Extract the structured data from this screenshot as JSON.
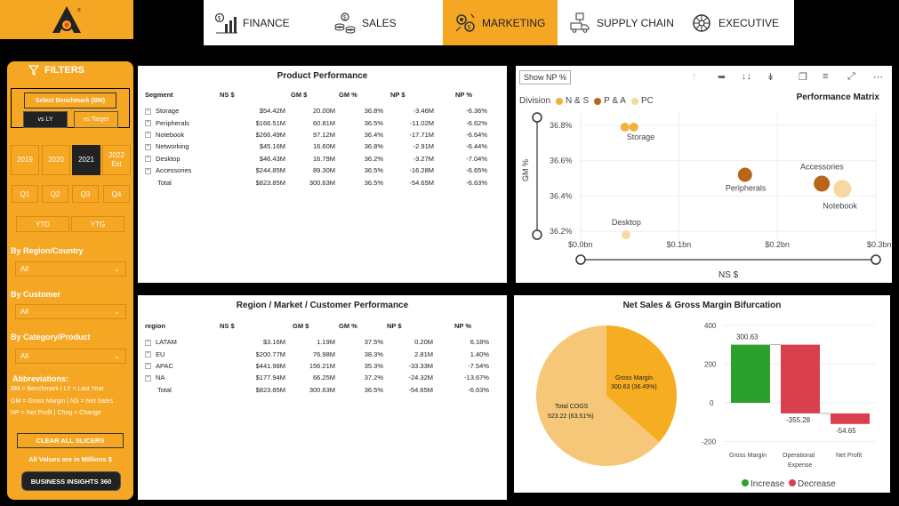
{
  "colors": {
    "accent": "#f5a623",
    "dark": "#222222",
    "increase": "#2ca02c",
    "decrease": "#d9404e",
    "ns": "#f2b13b",
    "pa": "#b8651a",
    "pc": "#f6d9a0",
    "pie_cogs": "#f6c778",
    "pie_gm": "#f6ad22"
  },
  "nav": {
    "tabs": [
      {
        "label": "FINANCE",
        "icon": "finance-chart-icon"
      },
      {
        "label": "SALES",
        "icon": "sales-coins-icon"
      },
      {
        "label": "MARKETING",
        "icon": "marketing-gears-icon",
        "active": true
      },
      {
        "label": "SUPPLY CHAIN",
        "icon": "supply-chain-truck-icon"
      },
      {
        "label": "EXECUTIVE",
        "icon": "executive-wheel-icon"
      }
    ]
  },
  "sidebar": {
    "title": "FILTERS",
    "benchmark_title": "Select Benchmark (BM)",
    "benchmark_options": [
      "vs LY",
      "vs Target"
    ],
    "years": [
      "2019",
      "2020",
      "2021",
      "2022 Est"
    ],
    "quarters": [
      "Q1",
      "Q2",
      "Q3",
      "Q4"
    ],
    "periods": [
      "YTD",
      "YTG"
    ],
    "filters": [
      {
        "label": "By Region/Country",
        "value": "All"
      },
      {
        "label": "By Customer",
        "value": "All"
      },
      {
        "label": "By Category/Product",
        "value": "All"
      }
    ],
    "abbr_title": "Abbreviations:",
    "abbr_lines": [
      "BM = Benchmark | LY = Last Year",
      "GM = Gross Margin | NS = Net Sales",
      "NP = Net Profit | Chng = Change"
    ],
    "clear_button": "CLEAR ALL SLICERS",
    "all_values": "All Values are in Millions $",
    "bi_button": "BUSINESS INSIGHTS 360"
  },
  "product_performance": {
    "title": "Product Performance",
    "columns": [
      "Segment",
      "NS $",
      "GM $",
      "GM %",
      "NP $",
      "NP %"
    ],
    "rows": [
      [
        "Storage",
        "$54.42M",
        "20.00M",
        "36.8%",
        "-3.46M",
        "-6.36%"
      ],
      [
        "Peripherals",
        "$166.51M",
        "60.81M",
        "36.5%",
        "-11.02M",
        "-6.62%"
      ],
      [
        "Notebook",
        "$266.49M",
        "97.12M",
        "36.4%",
        "-17.71M",
        "-6.64%"
      ],
      [
        "Networking",
        "$45.16M",
        "16.60M",
        "36.8%",
        "-2.91M",
        "-6.44%"
      ],
      [
        "Desktop",
        "$46.43M",
        "16.79M",
        "36.2%",
        "-3.27M",
        "-7.04%"
      ],
      [
        "Accessories",
        "$244.85M",
        "89.30M",
        "36.5%",
        "-16.28M",
        "-6.65%"
      ]
    ],
    "total": [
      "Total",
      "$823.85M",
      "300.63M",
      "36.5%",
      "-54.65M",
      "-6.63%"
    ]
  },
  "performance_matrix": {
    "show_np": "Show NP %",
    "title": "Performance Matrix",
    "legend_title": "Division",
    "legend": [
      "N & S",
      "P & A",
      "PC"
    ],
    "ylabel": "GM %",
    "xlabel": "NS $",
    "y_ticks": [
      "36.8%",
      "36.6%",
      "36.4%",
      "36.2%"
    ],
    "x_ticks": [
      "$0.0bn",
      "$0.1bn",
      "$0.2bn",
      "$0.3bn"
    ]
  },
  "region_performance": {
    "title": "Region / Market / Customer Performance",
    "columns": [
      "region",
      "NS $",
      "GM $",
      "GM %",
      "NP $",
      "NP %"
    ],
    "rows": [
      [
        "LATAM",
        "$3.16M",
        "1.19M",
        "37.5%",
        "0.20M",
        "6.18%"
      ],
      [
        "EU",
        "$200.77M",
        "76.98M",
        "38.3%",
        "2.81M",
        "1.40%"
      ],
      [
        "APAC",
        "$441.98M",
        "156.21M",
        "35.3%",
        "-33.33M",
        "-7.54%"
      ],
      [
        "NA",
        "$177.94M",
        "66.25M",
        "37.2%",
        "-24.32M",
        "-13.67%"
      ]
    ],
    "total": [
      "Total",
      "$823.85M",
      "300.63M",
      "36.5%",
      "-54.65M",
      "-6.63%"
    ]
  },
  "bifurcation": {
    "title": "Net Sales & Gross Margin Bifurcation",
    "pie_labels": [
      {
        "name": "Total COGS",
        "text": "523.22 (63.51%)"
      },
      {
        "name": "Gross Margin",
        "text": "300.63 (36.49%)"
      }
    ],
    "wf_y_ticks": [
      "400",
      "200",
      "0",
      "-200"
    ],
    "wf_categories": [
      "Gross Margin",
      "Operational Expense",
      "Net Profit"
    ],
    "wf_value_labels": [
      "300.63",
      "-355.28",
      "-54.65"
    ],
    "wf_legend": [
      "Increase",
      "Decrease"
    ]
  },
  "chart_data": [
    {
      "type": "scatter",
      "title": "Performance Matrix",
      "xlabel": "NS $",
      "ylabel": "GM %",
      "xlim": [
        0,
        0.3
      ],
      "ylim": [
        36.15,
        36.85
      ],
      "x_unit": "bn",
      "series": [
        {
          "name": "N & S",
          "points": [
            {
              "label": "Storage",
              "x": 0.054,
              "y": 36.79
            },
            {
              "label": "",
              "x": 0.045,
              "y": 36.79
            }
          ]
        },
        {
          "name": "P & A",
          "points": [
            {
              "label": "Peripherals",
              "x": 0.167,
              "y": 36.52
            },
            {
              "label": "Accessories",
              "x": 0.245,
              "y": 36.47
            }
          ]
        },
        {
          "name": "PC",
          "points": [
            {
              "label": "Notebook",
              "x": 0.266,
              "y": 36.44
            },
            {
              "label": "Desktop",
              "x": 0.046,
              "y": 36.18
            }
          ]
        }
      ]
    },
    {
      "type": "pie",
      "title": "Net Sales & Gross Margin Bifurcation",
      "categories": [
        "Total COGS",
        "Gross Margin"
      ],
      "values": [
        523.22,
        300.63
      ]
    },
    {
      "type": "bar",
      "subtype": "waterfall",
      "categories": [
        "Gross Margin",
        "Operational Expense",
        "Net Profit"
      ],
      "values": [
        300.63,
        -355.28,
        -54.65
      ],
      "ylim": [
        -200,
        400
      ]
    }
  ]
}
